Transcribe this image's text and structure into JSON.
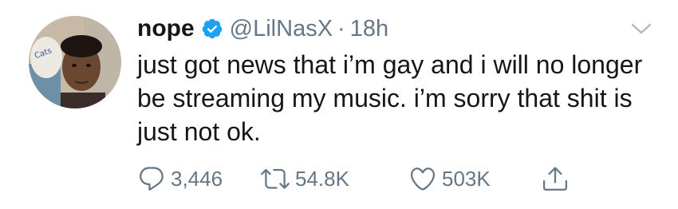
{
  "tweet": {
    "author_name": "nope",
    "handle": "@LilNasX",
    "separator": "·",
    "timestamp": "18h",
    "text": "just got news that i’m gay and i will no longer be streaming my music. i’m sorry that shit is just not ok.",
    "verified": true
  },
  "actions": {
    "reply_count": "3,446",
    "retweet_count": "54.8K",
    "like_count": "503K"
  },
  "icons": {
    "verified": "verified-badge-icon",
    "more": "chevron-down-icon",
    "reply": "reply-icon",
    "retweet": "retweet-icon",
    "like": "heart-icon",
    "share": "share-icon"
  },
  "colors": {
    "text": "#14171a",
    "secondary": "#657786",
    "verified_blue": "#1da1f2",
    "chevron": "#aab8c2"
  }
}
